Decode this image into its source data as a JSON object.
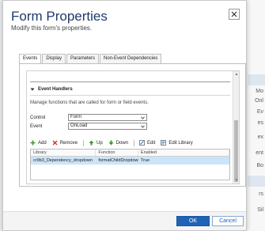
{
  "background": {
    "items": [
      "Mo",
      "Onl",
      "Ev",
      "es",
      "ex",
      "ent",
      "Bo",
      "rs",
      "Sil"
    ]
  },
  "dialog": {
    "title": "Form Properties",
    "subtitle": "Modify this form's properties.",
    "close_icon": "close-icon"
  },
  "tabs": [
    {
      "label": "Events",
      "active": true
    },
    {
      "label": "Display",
      "active": false
    },
    {
      "label": "Parameters",
      "active": false
    },
    {
      "label": "Non-Event Dependencies",
      "active": false
    }
  ],
  "event_handlers": {
    "heading": "Event Handlers",
    "description": "Manage functions that are called for form or field events.",
    "control_label": "Control",
    "control_value": "Form",
    "event_label": "Event",
    "event_value": "OnLoad",
    "toolbar": {
      "add": "Add",
      "remove": "Remove",
      "up": "Up",
      "down": "Down",
      "edit": "Edit",
      "edit_library": "Edit Library"
    },
    "grid": {
      "columns": [
        "Library",
        "Function",
        "Enabled"
      ],
      "rows": [
        [
          "cr9b3_Dependency_dropdown",
          "formatChildDropdown",
          "True"
        ]
      ]
    }
  },
  "footer": {
    "ok_label": "OK",
    "cancel_label": "Cancel"
  },
  "colors": {
    "accent": "#1f63b5",
    "title": "#1f3a6b",
    "selected_row": "#cce4f7"
  }
}
